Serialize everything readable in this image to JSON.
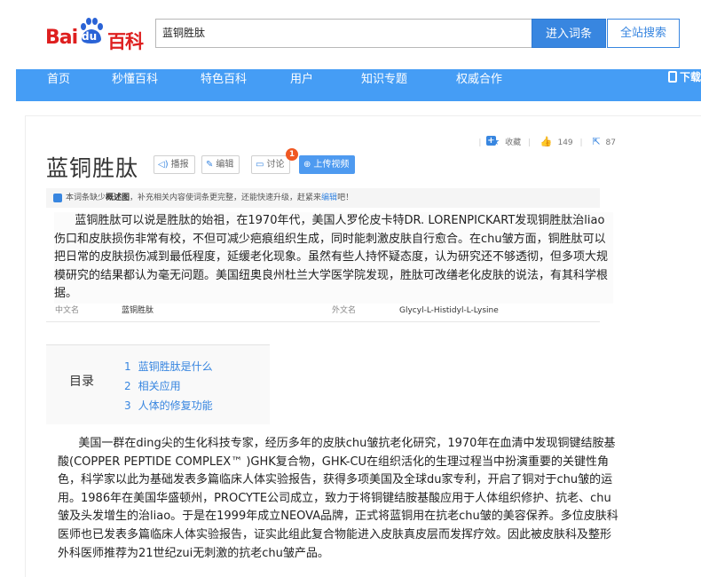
{
  "logo": {
    "bai": "Bai",
    "du": "du",
    "baike": "百科"
  },
  "search": {
    "value": "蓝铜胜肽",
    "enter_label": "进入词条",
    "all_label": "全站搜索"
  },
  "nav": {
    "items": [
      "首页",
      "秒懂百科",
      "特色百科",
      "用户",
      "知识专题",
      "权威合作"
    ],
    "download": "下载"
  },
  "page": {
    "title": "蓝铜胜肽"
  },
  "title_buttons": {
    "play": "播报",
    "edit": "编辑",
    "discuss": "讨论",
    "upload": "上传视频",
    "discuss_badge": "1"
  },
  "actions": {
    "collect_label": "收藏",
    "like_count": "149",
    "share_count": "87"
  },
  "notice": {
    "prefix": "本词条缺少",
    "bold": "概述图",
    "middle": "，补充相关内容使词条更完整，还能快速升级，赶紧来",
    "link": "编辑",
    "suffix": "吧！"
  },
  "summary": "蓝铜胜肽可以说是胜肽的始祖，在1970年代，美国人罗伦皮卡特DR. LORENPICKART发现铜胜肽治liao伤口和皮肤损伤非常有校，不但可减少疤痕组织生成，同时能刺激皮肤自行愈合。在chu皱方面，铜胜肽可以把日常的皮肤损伤减到最低程度，延缓老化现象。虽然有些人持怀疑态度，认为研究还不够透彻，但多项大规模研究的结果都认为毫无问题。美国纽奥良州杜兰大学医学院发现，胜肽可改缮老化皮肤的说法，有其科学根据。",
  "basic_info": {
    "cn_name_label": "中文名",
    "cn_name_value": "蓝铜胜肽",
    "foreign_name_label": "外文名",
    "foreign_name_value": "Glycyl-L-Histidyl-L-Lysine"
  },
  "toc": {
    "title": "目录",
    "items": [
      {
        "num": "1",
        "label": "蓝铜胜肽是什么"
      },
      {
        "num": "2",
        "label": "相关应用"
      },
      {
        "num": "3",
        "label": "人体的修复功能"
      }
    ]
  },
  "body": "美国一群在ding尖的生化科技专家，经历多年的皮肤chu皱抗老化研究，1970年在血清中发现铜键结胺基酸(COPPER PEPTIDE COMPLEX™ )GHK复合物，GHK-CU在组织活化的生理过程当中扮演重要的关键性角色，科学家以此为基础发表多篇临床人体实验报告，获得多项美国及全球du家专利，开启了铜对于chu皱的运用。1986年在美国华盛顿州，PROCYTE公司成立，致力于将铜键结胺基酸应用于人体组织修护、抗老、chu皱及头发增生的治liao。于是在1999年成立NEOVA品牌，正式将蓝铜用在抗老chu皱的美容保养。多位皮肤科医师也已发表多篇临床人体实验报告，证实此组此复合物能进入皮肤真皮层而发挥疗效。因此被皮肤科及整形外科医师推荐为21世纪zui无刺激的抗老chu皱产品。",
  "colors": {
    "brand_red": "#de1f1f",
    "brand_blue": "#3886e0",
    "nav_blue": "#459df5",
    "badge_orange": "#f05822"
  }
}
